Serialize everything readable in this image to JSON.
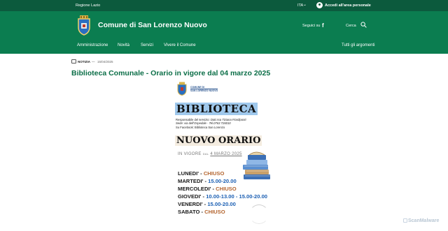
{
  "topbar": {
    "region": "Regione Lazio",
    "language": "ITA",
    "login": "Accedi all'area personale"
  },
  "header": {
    "title": "Comune di San Lorenzo Nuovo",
    "follow": "Seguici su",
    "search": "Cerca"
  },
  "nav": {
    "items": [
      "Amministrazione",
      "Novità",
      "Servizi",
      "Vivere il Comune"
    ],
    "all_topics": "Tutti gli argomenti"
  },
  "article": {
    "tag": "NOTIZIA",
    "separator": "—",
    "date": "15/04/2025",
    "title": "Biblioteca Comunale - Orario in vigore dal 04 marzo 2025"
  },
  "poster": {
    "comune_line1": "COMUNE DI",
    "comune_line2": "SAN LORENZO NUOVO",
    "heading": "BIBLIOTECA",
    "resp_label": "Responsabile del servizio: ",
    "resp_name": "Dott.ssa Tiziana Fiordiponti",
    "sede": "Sede: via dell'Ospedale - Tel.0763 726010",
    "facebook": "Su Facebook: Biblioteca San Lorenzo",
    "orario": "NUOVO ORARIO",
    "vigore_prefix": "IN VIGORE",
    "vigore_dal": "DAL",
    "vigore_date": "4 MARZO 2025",
    "days": [
      {
        "day": "LUNEDI' - ",
        "value": "CHIUSO",
        "closed": true
      },
      {
        "day": "MARTEDI' - ",
        "value": "15.00-20.00",
        "closed": false
      },
      {
        "day": "MERCOLEDI' - ",
        "value": "CHIUSO",
        "closed": true
      },
      {
        "day": "GIOVEDI' - ",
        "value": "10.00-13.00 - 15.00-20.00",
        "closed": false
      },
      {
        "day": "VENERDI' - ",
        "value": "15.00-20.00",
        "closed": false
      },
      {
        "day": "SABATO - ",
        "value": "CHIUSO",
        "closed": true
      }
    ]
  },
  "watermark": "ScanMalware",
  "colors": {
    "topbar": "#0c5a3d",
    "header": "#0b7d50",
    "title": "#0b6e47",
    "closed": "#b4652f",
    "hours": "#1b5fb3"
  }
}
